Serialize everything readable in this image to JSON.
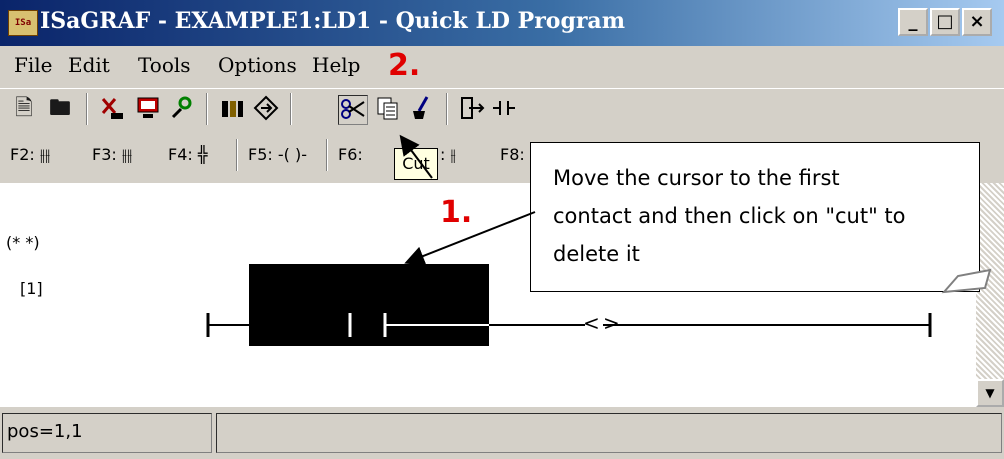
{
  "window": {
    "title": "ISaGRAF - EXAMPLE1:LD1 - Quick LD Program",
    "app_icon_label": "ISa",
    "minimize_symbol": "_",
    "maximize_symbol": "□",
    "close_symbol": "×"
  },
  "menu": {
    "items": [
      "File",
      "Edit",
      "Tools",
      "Options",
      "Help"
    ]
  },
  "annotations": {
    "step1": "1.",
    "step2": "2."
  },
  "toolbar": {
    "icons": [
      "new-doc-icon",
      "open-icon",
      "cut-spell-icon",
      "monitor-icon",
      "tools-icon",
      "library-icon",
      "compile-icon",
      "cut-icon",
      "copy-icon",
      "paste-brush-icon",
      "insert-icon",
      "contact-icon",
      "zoom-out-icon",
      "zoom-in-icon",
      "wire-icon",
      "grid-icon",
      "print-icon"
    ]
  },
  "function_keys": {
    "f2": "F2: ⫲⫲",
    "f3": "F3: ⫲⫲",
    "f4": "F4: ╬",
    "f5": "F5: -( )-",
    "f6": "F6: ",
    "f7": ": ⫲",
    "f8": "F8: "
  },
  "tooltip": "Cut",
  "diagram": {
    "comment": "(* *)",
    "rung_label": "[1]",
    "coil_left": "<",
    "coil_right": ">"
  },
  "callout": {
    "line1": "Move the cursor to the first",
    "line2": "contact and then click on \"cut\" to",
    "line3": "delete it"
  },
  "status": {
    "position": "pos=1,1"
  },
  "colors": {
    "title_gradient_start": "#0a246a",
    "title_gradient_end": "#a6caf0",
    "chrome": "#d4d0c8",
    "annotation_red": "#e00000",
    "selection": "#000000"
  }
}
